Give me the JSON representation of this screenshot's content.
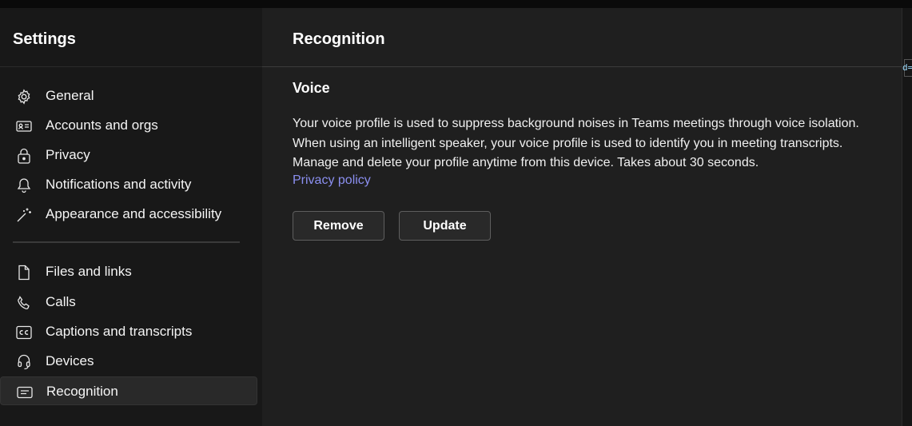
{
  "sidebar": {
    "title": "Settings",
    "items": [
      {
        "label": "General",
        "icon": "gear-icon",
        "selected": false
      },
      {
        "label": "Accounts and orgs",
        "icon": "id-card-icon",
        "selected": false
      },
      {
        "label": "Privacy",
        "icon": "lock-icon",
        "selected": false
      },
      {
        "label": "Notifications and activity",
        "icon": "bell-icon",
        "selected": false
      },
      {
        "label": "Appearance and accessibility",
        "icon": "magic-wand-icon",
        "selected": false
      },
      {
        "label": "Files and links",
        "icon": "document-icon",
        "selected": false
      },
      {
        "label": "Calls",
        "icon": "phone-icon",
        "selected": false
      },
      {
        "label": "Captions and transcripts",
        "icon": "closed-captions-icon",
        "selected": false
      },
      {
        "label": "Devices",
        "icon": "headset-icon",
        "selected": false
      },
      {
        "label": "Recognition",
        "icon": "recognition-icon",
        "selected": true
      }
    ]
  },
  "main": {
    "title": "Recognition",
    "section": {
      "title": "Voice",
      "description": "Your voice profile is used to suppress background noises in Teams meetings through voice isolation. When using an intelligent speaker, your voice profile is used to identify you in meeting transcripts. Manage and delete your profile anytime from this device. Takes about 30 seconds.",
      "link": "Privacy policy"
    },
    "buttons": {
      "remove": "Remove",
      "update": "Update"
    }
  },
  "edge_fragment": "d=",
  "colors": {
    "background": "#1f1f1f",
    "sidebar": "#181818",
    "link": "#8b8ff0",
    "selected_item": "#292929"
  }
}
